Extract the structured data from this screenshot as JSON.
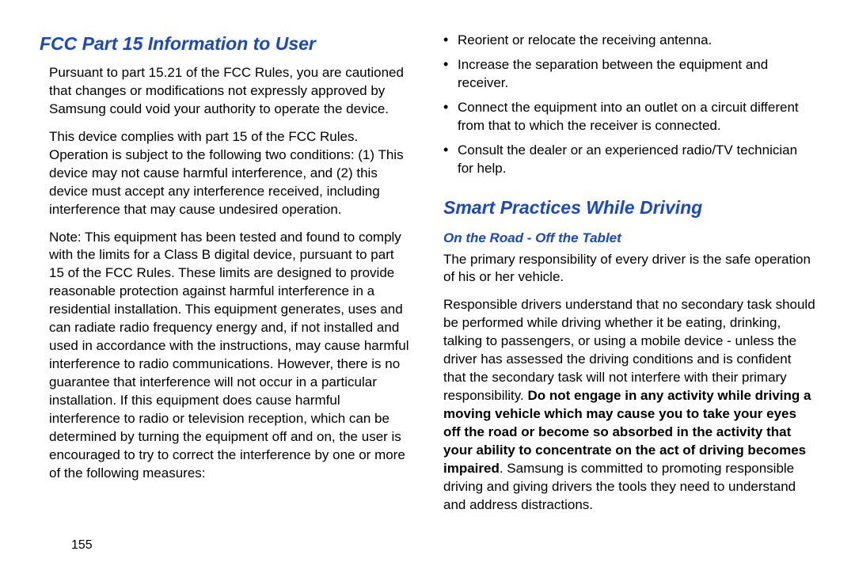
{
  "left": {
    "heading": "FCC Part 15 Information to User",
    "p1": "Pursuant to part 15.21 of the FCC Rules, you are cautioned that changes or modifications not expressly approved by Samsung could void your authority to operate the device.",
    "p2": "This device complies with part 15 of the FCC Rules. Operation is subject to the following two conditions: (1) This device may not cause harmful interference, and (2) this device must accept any interference received, including interference that may cause undesired operation.",
    "p3": "Note: This equipment has been tested and found to comply with the limits for a Class B digital device, pursuant to part 15 of the FCC Rules. These limits are designed to provide reasonable protection against harmful interference in a residential installation. This equipment generates, uses and can radiate radio frequency energy and, if not installed and used in accordance with the instructions, may cause harmful interference to radio communications. However, there is no guarantee that interference will not occur in a particular installation. If this equipment does cause harmful interference to radio or television reception, which can be determined by turning the equipment off and on, the user is encouraged to try to correct the interference by one or more of the following measures:",
    "pagenum": "155"
  },
  "right": {
    "bullets": [
      "Reorient or relocate the receiving antenna.",
      "Increase the separation between the equipment and receiver.",
      "Connect the equipment into an outlet on a circuit different from that to which the receiver is connected.",
      "Consult the dealer or an experienced radio/TV technician for help."
    ],
    "heading": "Smart Practices While Driving",
    "subheading": "On the Road - Off the Tablet",
    "p1": "The primary responsibility of every driver is the safe operation of his or her vehicle.",
    "p2a": "Responsible drivers understand that no secondary task should be performed while driving whether it be eating, drinking, talking to passengers, or using a mobile device - unless the driver has assessed the driving conditions and is confident that the secondary task will not interfere with their primary responsibility. ",
    "p2b": "Do not engage in any activity while driving a moving vehicle which may cause you to take your eyes off the road or become so absorbed in the activity that your ability to concentrate on the act of driving becomes impaired",
    "p2c": ". Samsung is committed to promoting responsible driving and giving drivers the tools they need to understand and address distractions."
  }
}
